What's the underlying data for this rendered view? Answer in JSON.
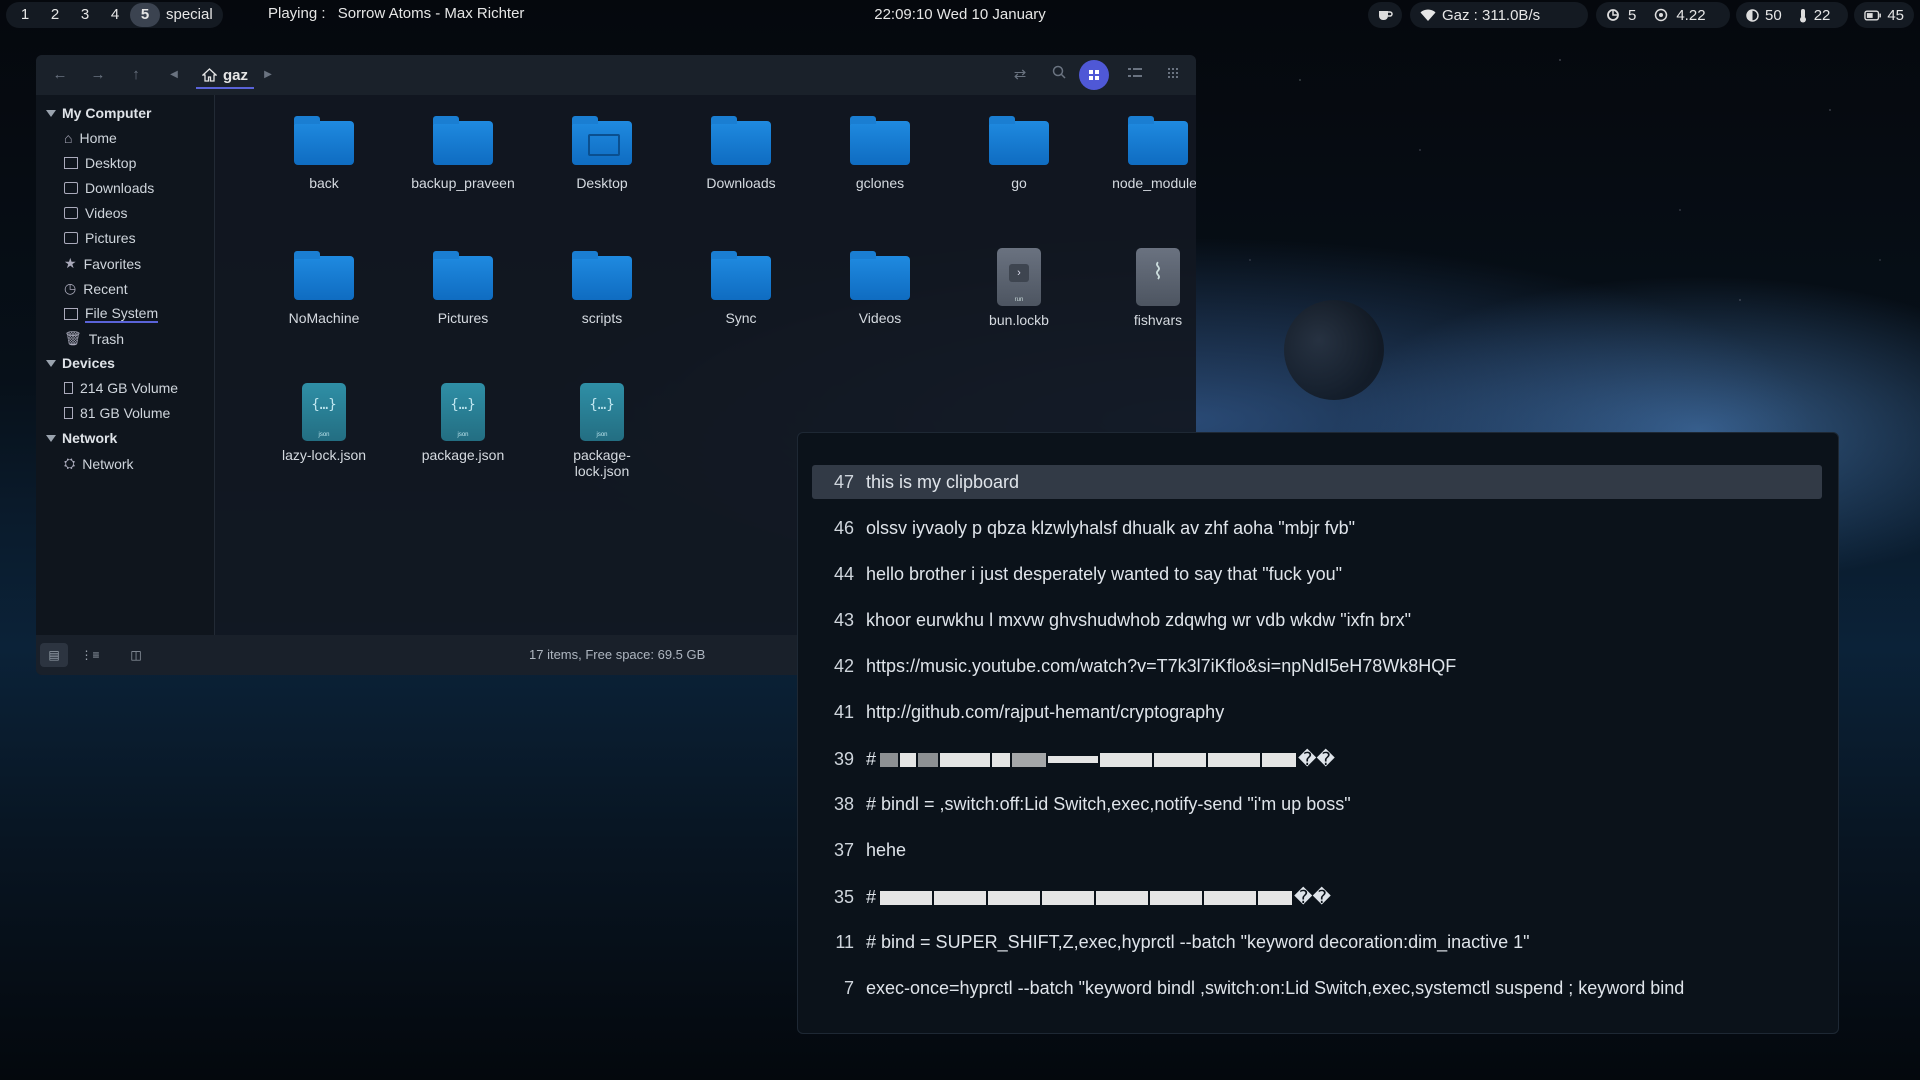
{
  "topbar": {
    "workspaces": [
      "1",
      "2",
      "3",
      "4",
      "5",
      "special"
    ],
    "active_workspace": "5",
    "playing_label": "Playing :",
    "playing_track": "Sorrow Atoms - Max Richter",
    "clock": "22:09:10  Wed 10 January",
    "network": "Gaz : 311.0B/s",
    "updates": "5",
    "cpu": "4.22",
    "brightness": "50",
    "temperature": "22",
    "battery": "45",
    "icons": [
      "coffee-icon",
      "wifi-icon",
      "updates-icon",
      "cpu-icon",
      "brightness-icon",
      "temperature-icon",
      "battery-icon"
    ]
  },
  "file_manager": {
    "path": "gaz",
    "sidebar": {
      "my_computer": "My Computer",
      "my_computer_items": [
        "Home",
        "Desktop",
        "Downloads",
        "Videos",
        "Pictures",
        "Favorites",
        "Recent",
        "File System",
        "Trash"
      ],
      "devices": "Devices",
      "device_items": [
        "214 GB Volume",
        "81 GB Volume"
      ],
      "network": "Network",
      "network_items": [
        "Network"
      ]
    },
    "items": [
      {
        "name": "back",
        "kind": "folder"
      },
      {
        "name": "backup_praveen",
        "kind": "folder"
      },
      {
        "name": "Desktop",
        "kind": "folder-desktop"
      },
      {
        "name": "Downloads",
        "kind": "folder"
      },
      {
        "name": "gclones",
        "kind": "folder"
      },
      {
        "name": "go",
        "kind": "folder"
      },
      {
        "name": "node_modules",
        "kind": "folder"
      },
      {
        "name": "NoMachine",
        "kind": "folder"
      },
      {
        "name": "Pictures",
        "kind": "folder"
      },
      {
        "name": "scripts",
        "kind": "folder"
      },
      {
        "name": "Sync",
        "kind": "folder"
      },
      {
        "name": "Videos",
        "kind": "folder"
      },
      {
        "name": "bun.lockb",
        "kind": "executable"
      },
      {
        "name": "fishvars",
        "kind": "attachment"
      },
      {
        "name": "lazy-lock.json",
        "kind": "json"
      },
      {
        "name": "package.json",
        "kind": "json"
      },
      {
        "name": "package-lock.json",
        "kind": "json"
      }
    ],
    "json_badge": "json",
    "run_badge": "run",
    "status": "17 items, Free space: 69.5 GB"
  },
  "clipboard": {
    "entries": [
      {
        "num": "47",
        "text": "this is my clipboard",
        "selected": true
      },
      {
        "num": "46",
        "text": "olssv iyvaoly p qbza klzwlyhalsf dhualk av zhf aoha \"mbjr fvb\""
      },
      {
        "num": "44",
        "text": "hello brother i just desperately wanted to say that \"fuck you\""
      },
      {
        "num": "43",
        "text": "khoor eurwkhu l mxvw ghvshudwhob zdqwhg wr vdb wkdw \"ixfn brx\""
      },
      {
        "num": "42",
        "text": "https://music.youtube.com/watch?v=T7k3l7iKflo&si=npNdI5eH78Wk8HQF"
      },
      {
        "num": "41",
        "text": "http://github.com/rajput-hemant/cryptography"
      },
      {
        "num": "39",
        "text": "#",
        "glyphs": "��"
      },
      {
        "num": "38",
        "text": "# bindl = ,switch:off:Lid Switch,exec,notify-send \"i'm up boss\""
      },
      {
        "num": "37",
        "text": "hehe"
      },
      {
        "num": "35",
        "text": "#",
        "glyphs": "��"
      },
      {
        "num": "11",
        "text": "# bind = SUPER_SHIFT,Z,exec,hyprctl --batch \"keyword decoration:dim_inactive 1\""
      },
      {
        "num": "7",
        "text": "exec-once=hyprctl --batch \"keyword bindl ,switch:on:Lid Switch,exec,systemctl suspend ; keyword bind"
      }
    ]
  }
}
